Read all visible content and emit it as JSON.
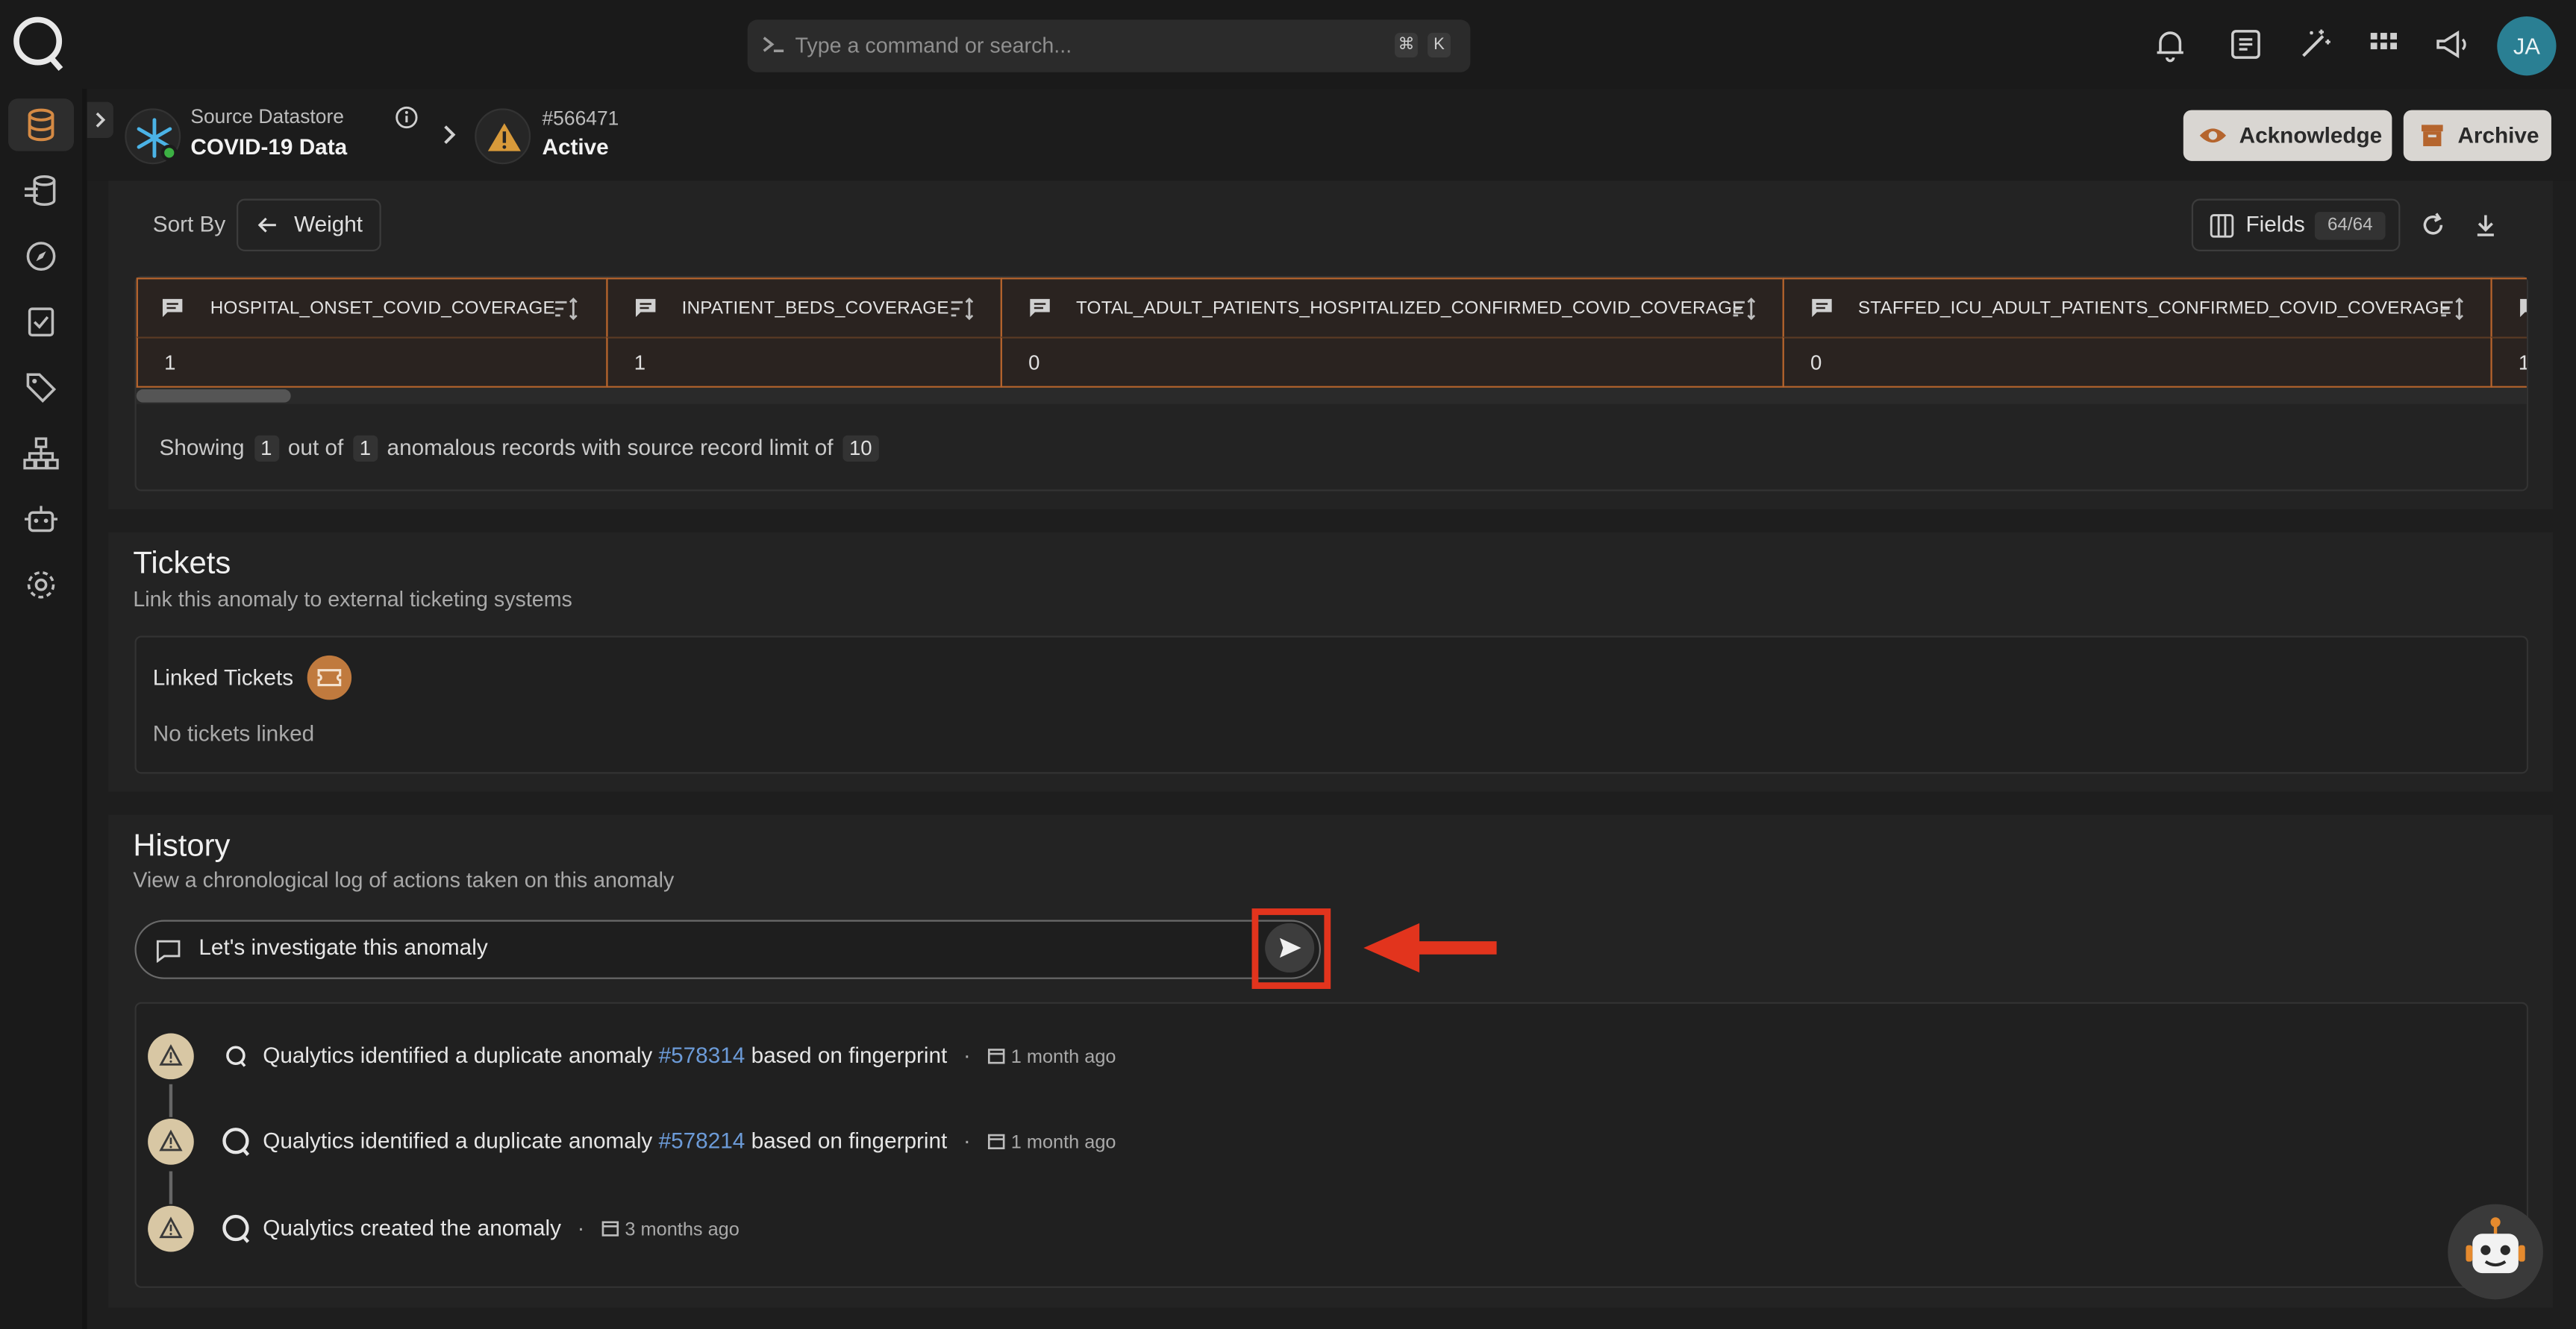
{
  "search": {
    "placeholder": "Type a command or search...",
    "shortcut_mod": "⌘",
    "shortcut_key": "K"
  },
  "user": {
    "initials": "JA"
  },
  "header": {
    "datastore_label": "Source Datastore",
    "datastore_name": "COVID-19 Data",
    "anomaly_id": "#566471",
    "anomaly_status": "Active",
    "acknowledge_label": "Acknowledge",
    "archive_label": "Archive"
  },
  "records": {
    "sort_by_label": "Sort By",
    "sort_value": "Weight",
    "fields_label": "Fields",
    "fields_count": "64/64",
    "columns": [
      {
        "name": "HOSPITAL_ONSET_COVID_COVERAGE",
        "value": "1"
      },
      {
        "name": "INPATIENT_BEDS_COVERAGE",
        "value": "1"
      },
      {
        "name": "TOTAL_ADULT_PATIENTS_HOSPITALIZED_CONFIRMED_COVID_COVERAGE",
        "value": "0"
      },
      {
        "name": "STAFFED_ICU_ADULT_PATIENTS_CONFIRMED_COVID_COVERAGE",
        "value": "0"
      },
      {
        "name": "",
        "value": "1"
      }
    ],
    "summary": {
      "showing": "Showing",
      "count": "1",
      "out_of": "out of",
      "total": "1",
      "suffix": "anomalous records with source record limit of",
      "limit": "10"
    }
  },
  "tickets": {
    "title": "Tickets",
    "subtitle": "Link this anomaly to external ticketing systems",
    "linked_label": "Linked Tickets",
    "empty_text": "No tickets linked"
  },
  "history": {
    "title": "History",
    "subtitle": "View a chronological log of actions taken on this anomaly",
    "comment_value": "Let's investigate this anomaly",
    "entries": [
      {
        "prefix": "Qualytics identified a duplicate anomaly",
        "link": "#578314",
        "suffix": "based on fingerprint",
        "time": "1 month ago"
      },
      {
        "prefix": "Qualytics identified a duplicate anomaly",
        "link": "#578214",
        "suffix": "based on fingerprint",
        "time": "1 month ago"
      },
      {
        "prefix": "Qualytics created the anomaly",
        "link": "",
        "suffix": "",
        "time": "3 months ago"
      }
    ]
  },
  "colors": {
    "accent": "#c07a3e",
    "highlight": "#e2341d",
    "link": "#6c9bd8",
    "avatar": "#2a7f93"
  }
}
